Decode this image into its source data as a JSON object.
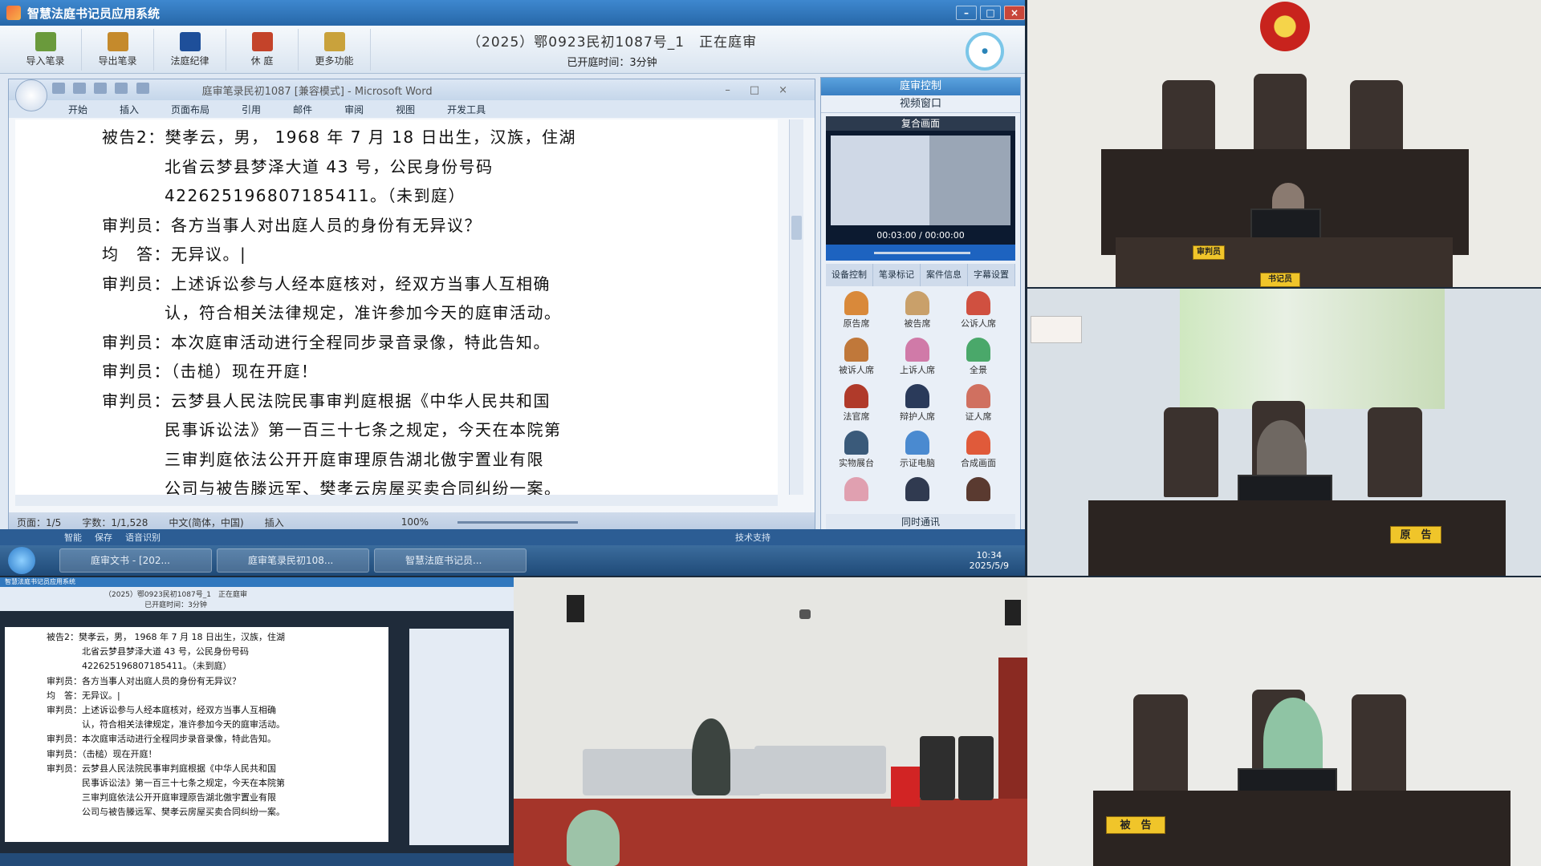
{
  "app": {
    "title": "智慧法庭书记员应用系统",
    "toolbar": [
      {
        "label": "导入笔录",
        "icon": "import-icon",
        "color": "#6a9a3c"
      },
      {
        "label": "导出笔录",
        "icon": "export-icon",
        "color": "#c58a2c"
      },
      {
        "label": "法庭纪律",
        "icon": "rules-book-icon",
        "color": "#1e4f9a"
      },
      {
        "label": "休 庭",
        "icon": "recess-icon",
        "color": "#c4432a"
      },
      {
        "label": "更多功能",
        "icon": "more-functions-icon",
        "color": "#c9a23c"
      }
    ],
    "case_title": "（2025）鄂0923民初1087号_1　正在庭审",
    "case_elapsed": "已开庭时间：3分钟"
  },
  "word": {
    "doc_title": "庭审笔录民初1087 [兼容模式] - Microsoft Word",
    "tabs": [
      "开始",
      "插入",
      "页面布局",
      "引用",
      "邮件",
      "审阅",
      "视图",
      "开发工具"
    ],
    "lines": [
      {
        "indent": 0,
        "text": "被告2：樊孝云，男， 1968 年 7 月 18 日出生，汉族，住湖"
      },
      {
        "indent": 1,
        "text": "北省云梦县梦泽大道 43 号，公民身份号码"
      },
      {
        "indent": 1,
        "text": "422625196807185411。（未到庭）"
      },
      {
        "indent": 0,
        "text": "审判员：各方当事人对出庭人员的身份有无异议？"
      },
      {
        "indent": 0,
        "text": "均　答：无异议。|"
      },
      {
        "indent": 0,
        "text": "审判员：上述诉讼参与人经本庭核对，经双方当事人互相确"
      },
      {
        "indent": 1,
        "text": "认，符合相关法律规定，准许参加今天的庭审活动。"
      },
      {
        "indent": 0,
        "text": "审判员：本次庭审活动进行全程同步录音录像，特此告知。"
      },
      {
        "indent": 0,
        "text": "审判员：（击槌）现在开庭！"
      },
      {
        "indent": 0,
        "text": "审判员：云梦县人民法院民事审判庭根据《中华人民共和国"
      },
      {
        "indent": 1,
        "text": "民事诉讼法》第一百三十七条之规定，今天在本院第"
      },
      {
        "indent": 1,
        "text": "三审判庭依法公开开庭审理原告湖北傲宇置业有限"
      },
      {
        "indent": 1,
        "text": "公司与被告滕远军、樊孝云房屋买卖合同纠纷一案。"
      }
    ],
    "status": {
      "page": "页面：1/5",
      "words": "字数：1/1,528",
      "language": "中文(简体，中国)",
      "mode": "插入",
      "zoom": "100%"
    }
  },
  "panel": {
    "header": "庭审控制",
    "video_window": "视频窗口",
    "composite": "复合画面",
    "video_time": "00:03:00 / 00:00:00",
    "tabs": [
      "设备控制",
      "笔录标记",
      "案件信息",
      "字幕设置"
    ],
    "roles": [
      {
        "label": "原告席",
        "color": "#d9893a"
      },
      {
        "label": "被告席",
        "color": "#c9a06a"
      },
      {
        "label": "公诉人席",
        "color": "#d05040"
      },
      {
        "label": "被诉人席",
        "color": "#c0783a"
      },
      {
        "label": "上诉人席",
        "color": "#d07aa8"
      },
      {
        "label": "全景",
        "color": "#4aa86a"
      },
      {
        "label": "法官席",
        "color": "#b03a2a"
      },
      {
        "label": "辩护人席",
        "color": "#2a3a5a"
      },
      {
        "label": "证人席",
        "color": "#d07060"
      },
      {
        "label": "实物展台",
        "color": "#3a5a7a"
      },
      {
        "label": "示证电脑",
        "color": "#4a8ad0"
      },
      {
        "label": "合成画面",
        "color": "#e05a3a"
      },
      {
        "label": "",
        "color": "#e0a0b0"
      },
      {
        "label": "",
        "color": "#303a50"
      },
      {
        "label": "",
        "color": "#5a3a30"
      }
    ],
    "footer": "同时通讯"
  },
  "app_status": [
    "智能",
    "保存",
    "语音识别"
  ],
  "app_status_right": "技术支持",
  "taskbar": {
    "tasks": [
      "庭审文书 - [202...",
      "庭审笔录民初108...",
      "智慧法庭书记员..."
    ],
    "time": "10:34",
    "date": "2025/5/9"
  },
  "feeds": {
    "clerk_tag": "书记员",
    "clerk_desk_tag": "审判员",
    "plaintiff_tag": "原　告",
    "defendant_tag": "被　告"
  }
}
